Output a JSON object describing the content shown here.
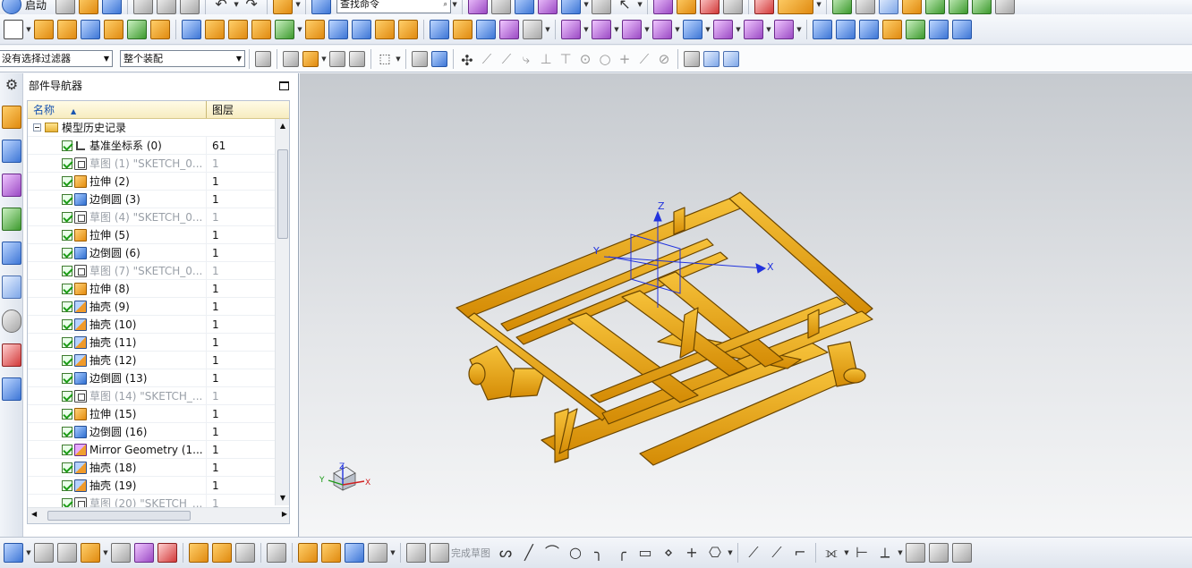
{
  "menu": {
    "start_label": "启动",
    "command_finder_placeholder": "查找命令"
  },
  "selection_bar": {
    "filter_value": "没有选择过滤器",
    "scope_value": "整个装配"
  },
  "navigator": {
    "title": "部件导航器",
    "col_name": "名称",
    "col_layer": "图层",
    "root_label": "模型历史记录",
    "features": [
      {
        "label": "基准坐标系 (0)",
        "layer": "61",
        "icon": "datum-csys-icon",
        "dim": false
      },
      {
        "label": "草图 (1) \"SKETCH_0...",
        "layer": "1",
        "icon": "sketch-icon",
        "dim": true
      },
      {
        "label": "拉伸 (2)",
        "layer": "1",
        "icon": "extrude-icon",
        "dim": false
      },
      {
        "label": "边倒圆 (3)",
        "layer": "1",
        "icon": "edge-blend-icon",
        "dim": false
      },
      {
        "label": "草图 (4) \"SKETCH_0...",
        "layer": "1",
        "icon": "sketch-icon",
        "dim": true
      },
      {
        "label": "拉伸 (5)",
        "layer": "1",
        "icon": "extrude-icon",
        "dim": false
      },
      {
        "label": "边倒圆 (6)",
        "layer": "1",
        "icon": "edge-blend-icon",
        "dim": false
      },
      {
        "label": "草图 (7) \"SKETCH_0...",
        "layer": "1",
        "icon": "sketch-icon",
        "dim": true
      },
      {
        "label": "拉伸 (8)",
        "layer": "1",
        "icon": "extrude-icon",
        "dim": false
      },
      {
        "label": "抽壳 (9)",
        "layer": "1",
        "icon": "shell-icon",
        "dim": false
      },
      {
        "label": "抽壳 (10)",
        "layer": "1",
        "icon": "shell-icon",
        "dim": false
      },
      {
        "label": "抽壳 (11)",
        "layer": "1",
        "icon": "shell-icon",
        "dim": false
      },
      {
        "label": "抽壳 (12)",
        "layer": "1",
        "icon": "shell-icon",
        "dim": false
      },
      {
        "label": "边倒圆 (13)",
        "layer": "1",
        "icon": "edge-blend-icon",
        "dim": false
      },
      {
        "label": "草图 (14) \"SKETCH_...",
        "layer": "1",
        "icon": "sketch-icon",
        "dim": true
      },
      {
        "label": "拉伸 (15)",
        "layer": "1",
        "icon": "extrude-icon",
        "dim": false
      },
      {
        "label": "边倒圆 (16)",
        "layer": "1",
        "icon": "edge-blend-icon",
        "dim": false
      },
      {
        "label": "Mirror Geometry (1...",
        "layer": "1",
        "icon": "mirror-geometry-icon",
        "dim": false
      },
      {
        "label": "抽壳 (18)",
        "layer": "1",
        "icon": "shell-icon",
        "dim": false
      },
      {
        "label": "抽壳 (19)",
        "layer": "1",
        "icon": "shell-icon",
        "dim": false
      },
      {
        "label": "草图 (20) \"SKETCH_...",
        "layer": "1",
        "icon": "sketch-icon",
        "dim": true
      }
    ]
  },
  "viewport": {
    "axis_x": "X",
    "axis_y": "Y",
    "axis_z": "Z",
    "model_color": "#e8a90f"
  },
  "bottom_toolbar": {
    "finish_sketch_label": "完成草图"
  },
  "colors": {
    "accent": "#1a55b0",
    "frame_orange": "#e8a90f",
    "frame_dark": "#7a5200",
    "csys_blue": "#2233dd"
  }
}
